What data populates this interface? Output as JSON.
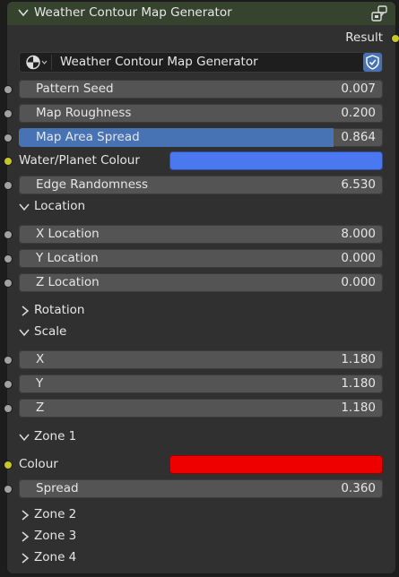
{
  "node": {
    "title": "Weather Contour Map Generator",
    "header_color": "#35432f",
    "output_label": "Result",
    "group_name": "Weather Contour Map Generator"
  },
  "inputs": {
    "pattern_seed": {
      "label": "Pattern Seed",
      "value": "0.007"
    },
    "map_roughness": {
      "label": "Map Roughness",
      "value": "0.200"
    },
    "map_area_spread": {
      "label": "Map Area Spread",
      "value": "0.864",
      "fill_fraction": 0.864
    },
    "water_planet_colour": {
      "label": "Water/Planet Colour",
      "color": "#4a78f0"
    },
    "edge_randomness": {
      "label": "Edge Randomness",
      "value": "6.530"
    }
  },
  "location": {
    "label": "Location",
    "x": {
      "label": "X Location",
      "value": "8.000"
    },
    "y": {
      "label": "Y Location",
      "value": "0.000"
    },
    "z": {
      "label": "Z Location",
      "value": "0.000"
    }
  },
  "rotation": {
    "label": "Rotation"
  },
  "scale": {
    "label": "Scale",
    "x": {
      "label": "X",
      "value": "1.180"
    },
    "y": {
      "label": "Y",
      "value": "1.180"
    },
    "z": {
      "label": "Z",
      "value": "1.180"
    }
  },
  "zone1": {
    "label": "Zone 1",
    "colour": {
      "label": "Colour",
      "color": "#ee0000"
    },
    "spread": {
      "label": "Spread",
      "value": "0.360"
    }
  },
  "zone2": {
    "label": "Zone 2"
  },
  "zone3": {
    "label": "Zone 3"
  },
  "zone4": {
    "label": "Zone 4"
  },
  "icons": {
    "header_toggle": "chevron-down-icon",
    "node_group": "node-group-icon",
    "browse": "node-tree-icon",
    "fake_user": "shield-icon",
    "panel_open": "chevron-down-icon",
    "panel_closed": "chevron-right-icon"
  },
  "colors": {
    "accent": "#4772b3",
    "float_socket": "#a1a1a1",
    "color_socket": "#c7c729"
  }
}
